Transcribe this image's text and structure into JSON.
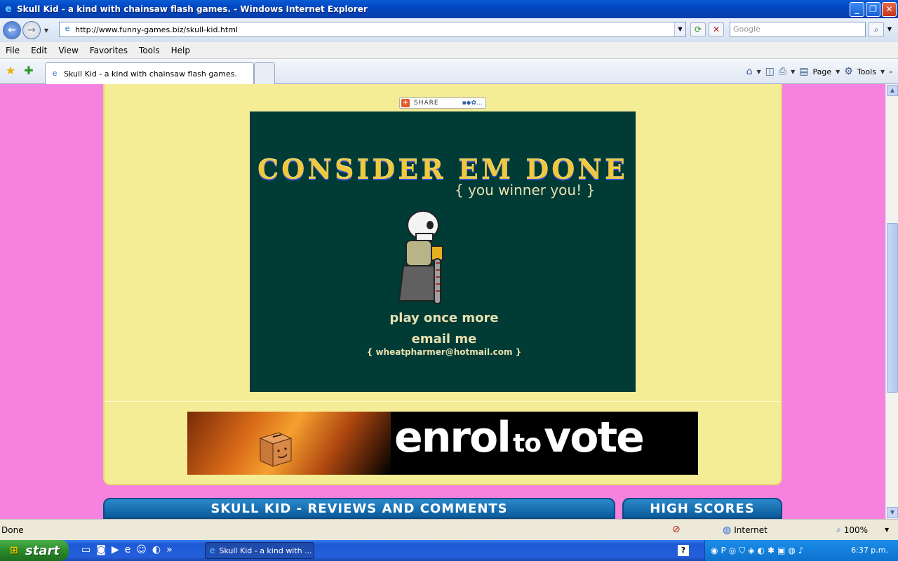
{
  "window": {
    "title": "Skull Kid - a kind with chainsaw flash games. - Windows Internet Explorer",
    "minimize": "_",
    "maximize": "❐",
    "close": "✕"
  },
  "address": {
    "url": "http://www.funny-games.biz/skull-kid.html",
    "search_placeholder": "Google"
  },
  "menu": [
    "File",
    "Edit",
    "View",
    "Favorites",
    "Tools",
    "Help"
  ],
  "tab": {
    "label": "Skull Kid - a kind with chainsaw flash games."
  },
  "commandbar": {
    "page": "Page",
    "tools": "Tools"
  },
  "page": {
    "share_label": "SHARE",
    "game": {
      "title": "CONSIDER EM DONE",
      "subtitle": "{ you winner you! }",
      "play_again": "play once more",
      "email_me": "email me",
      "email_address": "{ wheatpharmer@hotmail.com }"
    },
    "banner": {
      "word1": "enrol",
      "word2": "to",
      "word3": "vote"
    },
    "reviews_header": "SKULL KID - REVIEWS AND COMMENTS",
    "scores_header": "HIGH SCORES"
  },
  "status": {
    "text": "Done",
    "zone": "Internet",
    "zoom": "100%"
  },
  "taskbar": {
    "start": "start",
    "task_item": "Skull Kid - a kind with ...",
    "clock": "6:37 p.m."
  },
  "colors": {
    "page_bg": "#f682e0",
    "panel_bg": "#f4ed96",
    "game_bg": "#003b36",
    "header_blue": "#0a5a9a"
  }
}
